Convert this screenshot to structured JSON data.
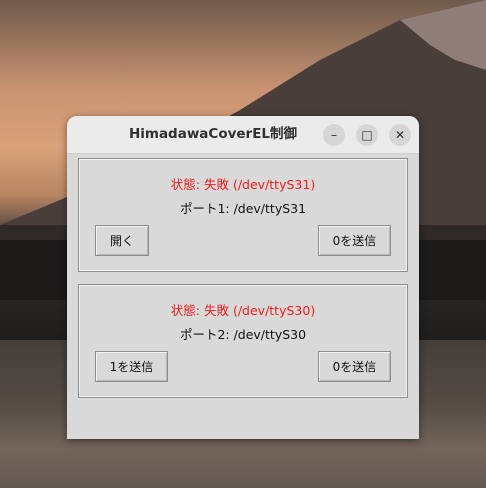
{
  "window": {
    "title": "HimadawaCoverEL制御",
    "controls": {
      "minimize": "–",
      "maximize": "□",
      "close": "✕"
    }
  },
  "panels": [
    {
      "status": "状態: 失敗 (/dev/ttyS31)",
      "port": "ポート1: /dev/ttyS31",
      "left_button": "開く",
      "right_button": "0を送信"
    },
    {
      "status": "状態: 失敗 (/dev/ttyS30)",
      "port": "ポート2: /dev/ttyS30",
      "left_button": "1を送信",
      "right_button": "0を送信"
    }
  ],
  "colors": {
    "status_error": "#f21b1b",
    "window_bg": "#d9d9d9"
  }
}
